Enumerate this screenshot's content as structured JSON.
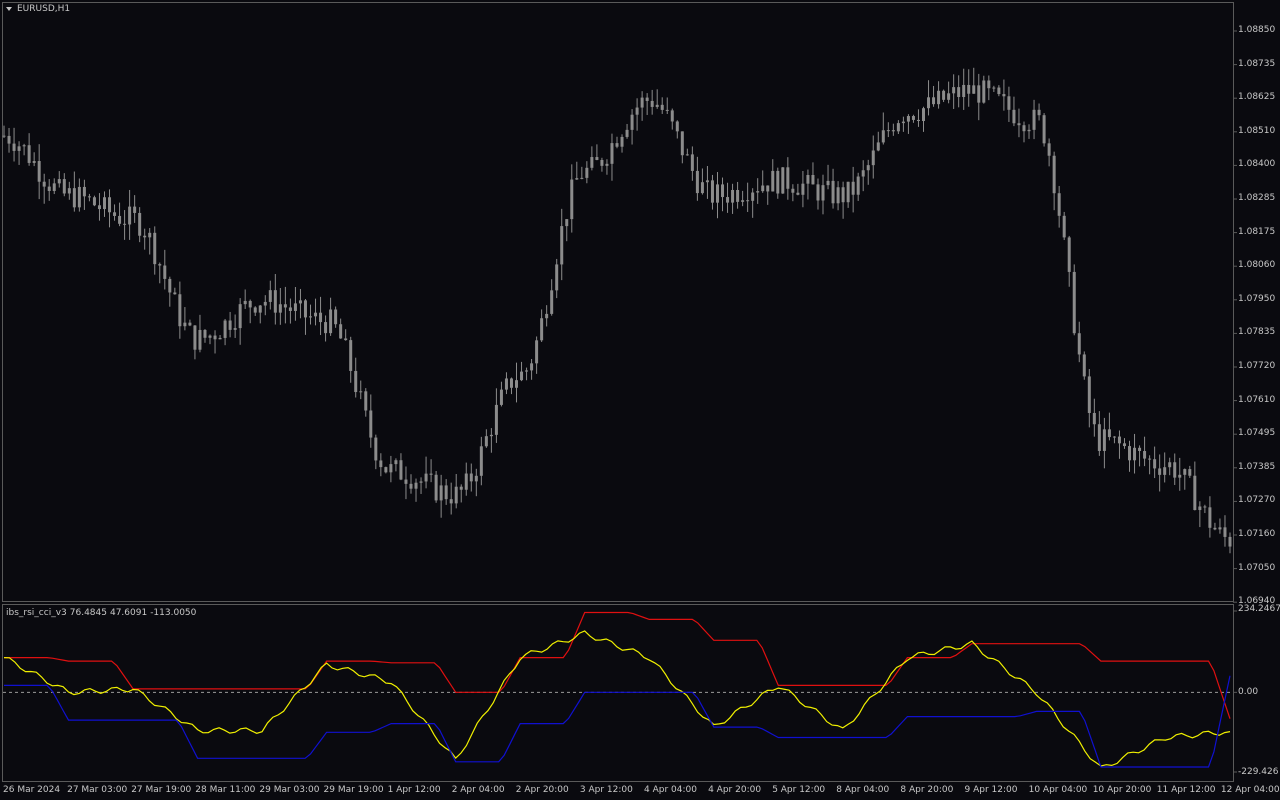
{
  "chart": {
    "symbol_label": "EURUSD,H1",
    "candle_color": "#8c8c8c",
    "background": "#0a0a0f",
    "price_ticks": [
      "1.08850",
      "1.08735",
      "1.08625",
      "1.08510",
      "1.08400",
      "1.08285",
      "1.08175",
      "1.08060",
      "1.07950",
      "1.07835",
      "1.07720",
      "1.07610",
      "1.07495",
      "1.07385",
      "1.07270",
      "1.07160",
      "1.07050",
      "1.06940"
    ]
  },
  "indicator": {
    "name": "ibs_rsi_cci_v3",
    "value1": "76.4845",
    "value2": "47.6091",
    "value3": "-113.0050",
    "axis_max": "234.2467",
    "axis_zero": "0.00",
    "axis_min": "-229.426",
    "colors": {
      "red_line": "#e01010",
      "yellow_line": "#f0f000",
      "blue_line": "#1010d0",
      "zero_line": "#9a9a9a"
    }
  },
  "time_axis": {
    "labels": [
      "26 Mar 2024",
      "27 Mar 03:00",
      "27 Mar 19:00",
      "28 Mar 11:00",
      "29 Mar 03:00",
      "29 Mar 19:00",
      "1 Apr 12:00",
      "2 Apr 04:00",
      "2 Apr 20:00",
      "3 Apr 12:00",
      "4 Apr 04:00",
      "4 Apr 20:00",
      "5 Apr 12:00",
      "8 Apr 04:00",
      "8 Apr 20:00",
      "9 Apr 12:00",
      "10 Apr 04:00",
      "10 Apr 20:00",
      "11 Apr 12:00",
      "12 Apr 04:00"
    ]
  },
  "chart_data": [
    {
      "type": "candlestick",
      "title": "EURUSD,H1",
      "ylim": [
        1.0694,
        1.0891
      ],
      "x": [
        "26 Mar 2024",
        "27 Mar 03:00",
        "27 Mar 19:00",
        "28 Mar 11:00",
        "29 Mar 03:00",
        "29 Mar 19:00",
        "1 Apr 12:00",
        "2 Apr 04:00",
        "2 Apr 20:00",
        "3 Apr 12:00",
        "4 Apr 04:00",
        "4 Apr 20:00",
        "5 Apr 12:00",
        "8 Apr 04:00",
        "8 Apr 20:00",
        "9 Apr 12:00",
        "10 Apr 04:00",
        "10 Apr 20:00",
        "11 Apr 12:00",
        "12 Apr 04:00"
      ],
      "series": [
        {
          "values": [
            1.085,
            1.083,
            1.0822,
            1.0782,
            1.0795,
            1.0788,
            1.0738,
            1.073,
            1.077,
            1.0838,
            1.0862,
            1.083,
            1.0835,
            1.083,
            1.0858,
            1.0865,
            1.0855,
            1.0748,
            1.074,
            1.0715
          ]
        }
      ]
    },
    {
      "type": "line",
      "title": "ibs_rsi_cci_v3",
      "ylim": [
        -229.426,
        234.2467
      ],
      "x": [
        "26 Mar 2024",
        "27 Mar 03:00",
        "27 Mar 19:00",
        "28 Mar 11:00",
        "29 Mar 03:00",
        "29 Mar 19:00",
        "1 Apr 12:00",
        "2 Apr 04:00",
        "2 Apr 20:00",
        "3 Apr 12:00",
        "4 Apr 04:00",
        "4 Apr 20:00",
        "5 Apr 12:00",
        "8 Apr 04:00",
        "8 Apr 20:00",
        "9 Apr 12:00",
        "10 Apr 04:00",
        "10 Apr 20:00",
        "11 Apr 12:00",
        "12 Apr 04:00"
      ],
      "series": [
        {
          "values": [
            100,
            90,
            10,
            10,
            10,
            90,
            85,
            0,
            100,
            230,
            210,
            150,
            20,
            20,
            100,
            140,
            140,
            90,
            90,
            -76
          ]
        },
        {
          "values": [
            100,
            0,
            10,
            -110,
            -110,
            80,
            30,
            -195,
            100,
            170,
            100,
            -100,
            20,
            -110,
            100,
            140,
            0,
            -220,
            -130,
            -113
          ]
        },
        {
          "values": [
            20,
            -80,
            -80,
            -190,
            -190,
            -115,
            -90,
            -200,
            -90,
            0,
            0,
            -100,
            -130,
            -130,
            -70,
            -70,
            -55,
            -215,
            -215,
            48
          ]
        }
      ]
    }
  ]
}
